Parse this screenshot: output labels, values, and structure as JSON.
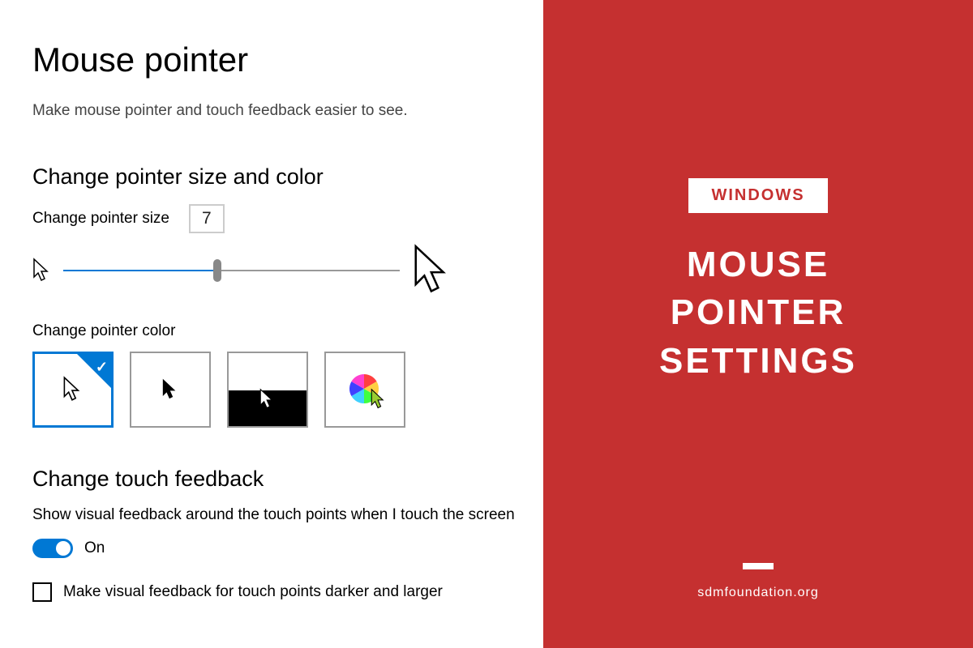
{
  "page": {
    "title": "Mouse pointer",
    "subtitle": "Make mouse pointer and touch feedback easier to see."
  },
  "sections": {
    "size_color": {
      "heading": "Change pointer size and color",
      "size_label": "Change pointer size",
      "size_value": "7",
      "color_label": "Change pointer color"
    },
    "touch": {
      "heading": "Change touch feedback",
      "description": "Show visual feedback around the touch points when I touch the screen",
      "toggle_state": "On",
      "checkbox_label": "Make visual feedback for touch points darker and larger"
    }
  },
  "banner": {
    "badge": "WINDOWS",
    "title_line1": "MOUSE",
    "title_line2": "POINTER",
    "title_line3": "SETTINGS",
    "footer": "sdmfoundation.org"
  },
  "colors": {
    "accent": "#0078d4",
    "banner_bg": "#c53030"
  }
}
